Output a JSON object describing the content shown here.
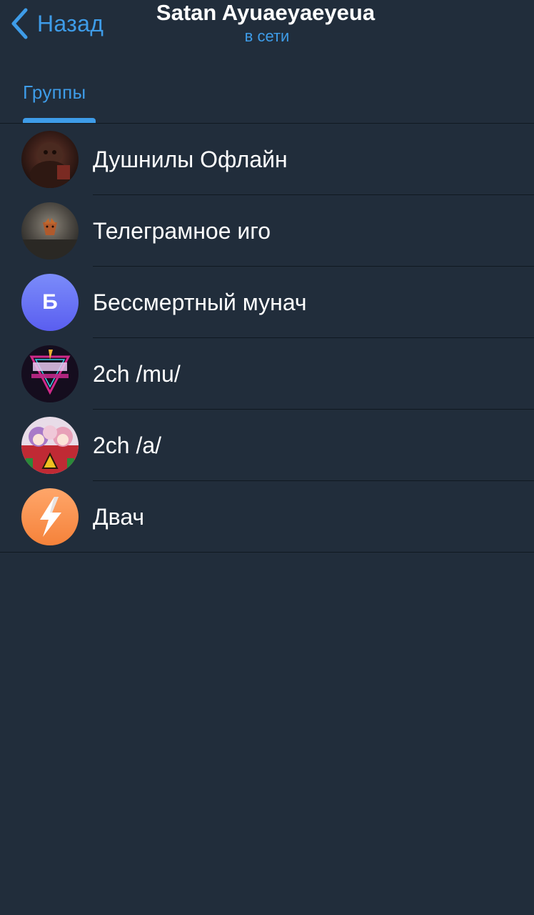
{
  "header": {
    "back_label": "Назад",
    "title": "Satan Ayuaeyaeyeua",
    "status": "в сети"
  },
  "tabs": [
    {
      "label": "Группы",
      "active": true
    }
  ],
  "groups": [
    {
      "name": "Душнилы Офлайн",
      "avatar": "photo"
    },
    {
      "name": "Телеграмное иго",
      "avatar": "photo"
    },
    {
      "name": "Бессмертный мунач",
      "avatar": "letter",
      "letter": "Б"
    },
    {
      "name": "2ch /mu/",
      "avatar": "logo"
    },
    {
      "name": "2ch /a/",
      "avatar": "photo"
    },
    {
      "name": "Двач",
      "avatar": "lightning-icon"
    }
  ],
  "colors": {
    "background": "#212d3b",
    "accent": "#3e9ce8",
    "separator": "#101921",
    "text": "#ffffff"
  }
}
